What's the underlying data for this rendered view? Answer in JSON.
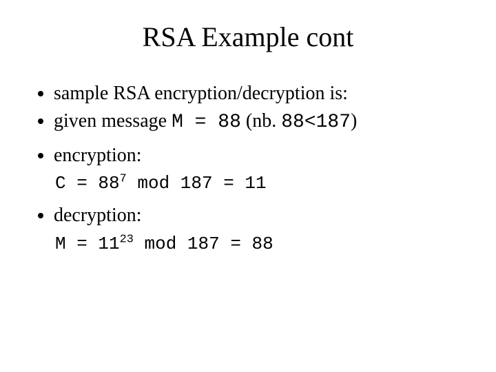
{
  "title": "RSA Example cont",
  "bullets": {
    "b1": "sample RSA encryption/decryption is:",
    "b2_pre": "given message ",
    "b2_code": "M = 88",
    "b2_mid": " (nb. ",
    "b2_cond": "88<187",
    "b2_post": ")",
    "b3": "encryption:",
    "b4": "decryption:"
  },
  "formulas": {
    "enc_pre": "C = 88",
    "enc_exp": "7",
    "enc_post": " mod 187 = 11",
    "dec_pre": "M = 11",
    "dec_exp": "23",
    "dec_post": " mod 187 = 88"
  }
}
